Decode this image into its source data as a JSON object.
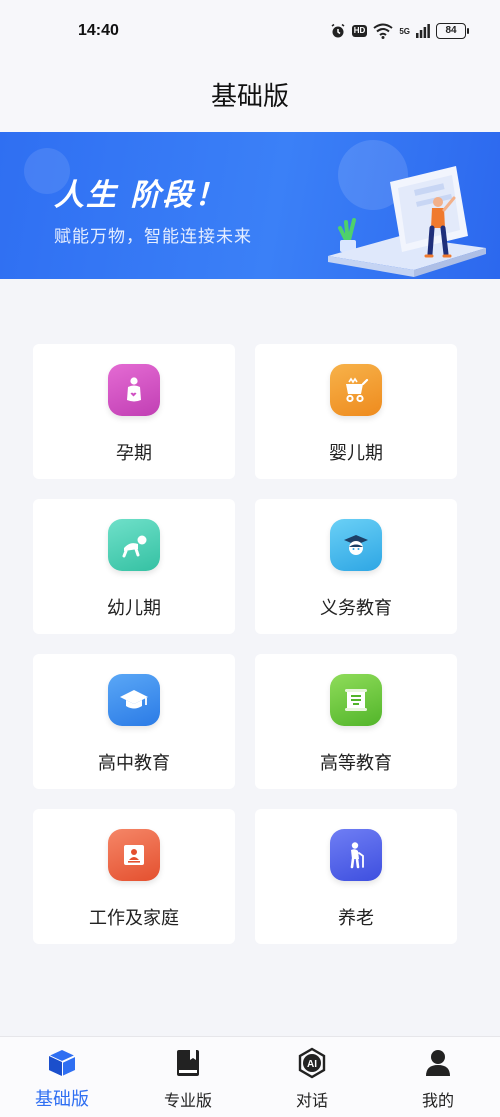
{
  "status_bar": {
    "time": "14:40",
    "hd": "HD",
    "signal": "5G",
    "battery": "84"
  },
  "header": {
    "title": "基础版"
  },
  "banner": {
    "title": "人生 阶段！",
    "subtitle": "赋能万物，智能连接未来"
  },
  "stages": [
    {
      "label": "孕期",
      "icon": "pregnancy-icon",
      "color_from": "#e46bd3",
      "color_to": "#c13fb4"
    },
    {
      "label": "婴儿期",
      "icon": "stroller-icon",
      "color_from": "#f7b24a",
      "color_to": "#ee8b1e"
    },
    {
      "label": "幼儿期",
      "icon": "crawling-baby-icon",
      "color_from": "#6fe0c9",
      "color_to": "#35c1a3"
    },
    {
      "label": "义务教育",
      "icon": "student-icon",
      "color_from": "#6ad0f6",
      "color_to": "#2ea6e4"
    },
    {
      "label": "高中教育",
      "icon": "graduation-cap-icon",
      "color_from": "#5aa7f6",
      "color_to": "#2b7be6"
    },
    {
      "label": "高等教育",
      "icon": "scroll-icon",
      "color_from": "#8fdc5a",
      "color_to": "#52b52a"
    },
    {
      "label": "工作及家庭",
      "icon": "work-id-icon",
      "color_from": "#f58667",
      "color_to": "#e4502f"
    },
    {
      "label": "养老",
      "icon": "elderly-icon",
      "color_from": "#6f7ef4",
      "color_to": "#3e4fdf"
    }
  ],
  "bottom_nav": [
    {
      "label": "基础版",
      "icon": "cube-icon",
      "active": true
    },
    {
      "label": "专业版",
      "icon": "book-icon",
      "active": false
    },
    {
      "label": "对话",
      "icon": "ai-chat-icon",
      "active": false
    },
    {
      "label": "我的",
      "icon": "profile-icon",
      "active": false
    }
  ],
  "colors": {
    "accent": "#2f6ff2",
    "banner": "#3b80f7",
    "background": "#f4f5f9"
  }
}
